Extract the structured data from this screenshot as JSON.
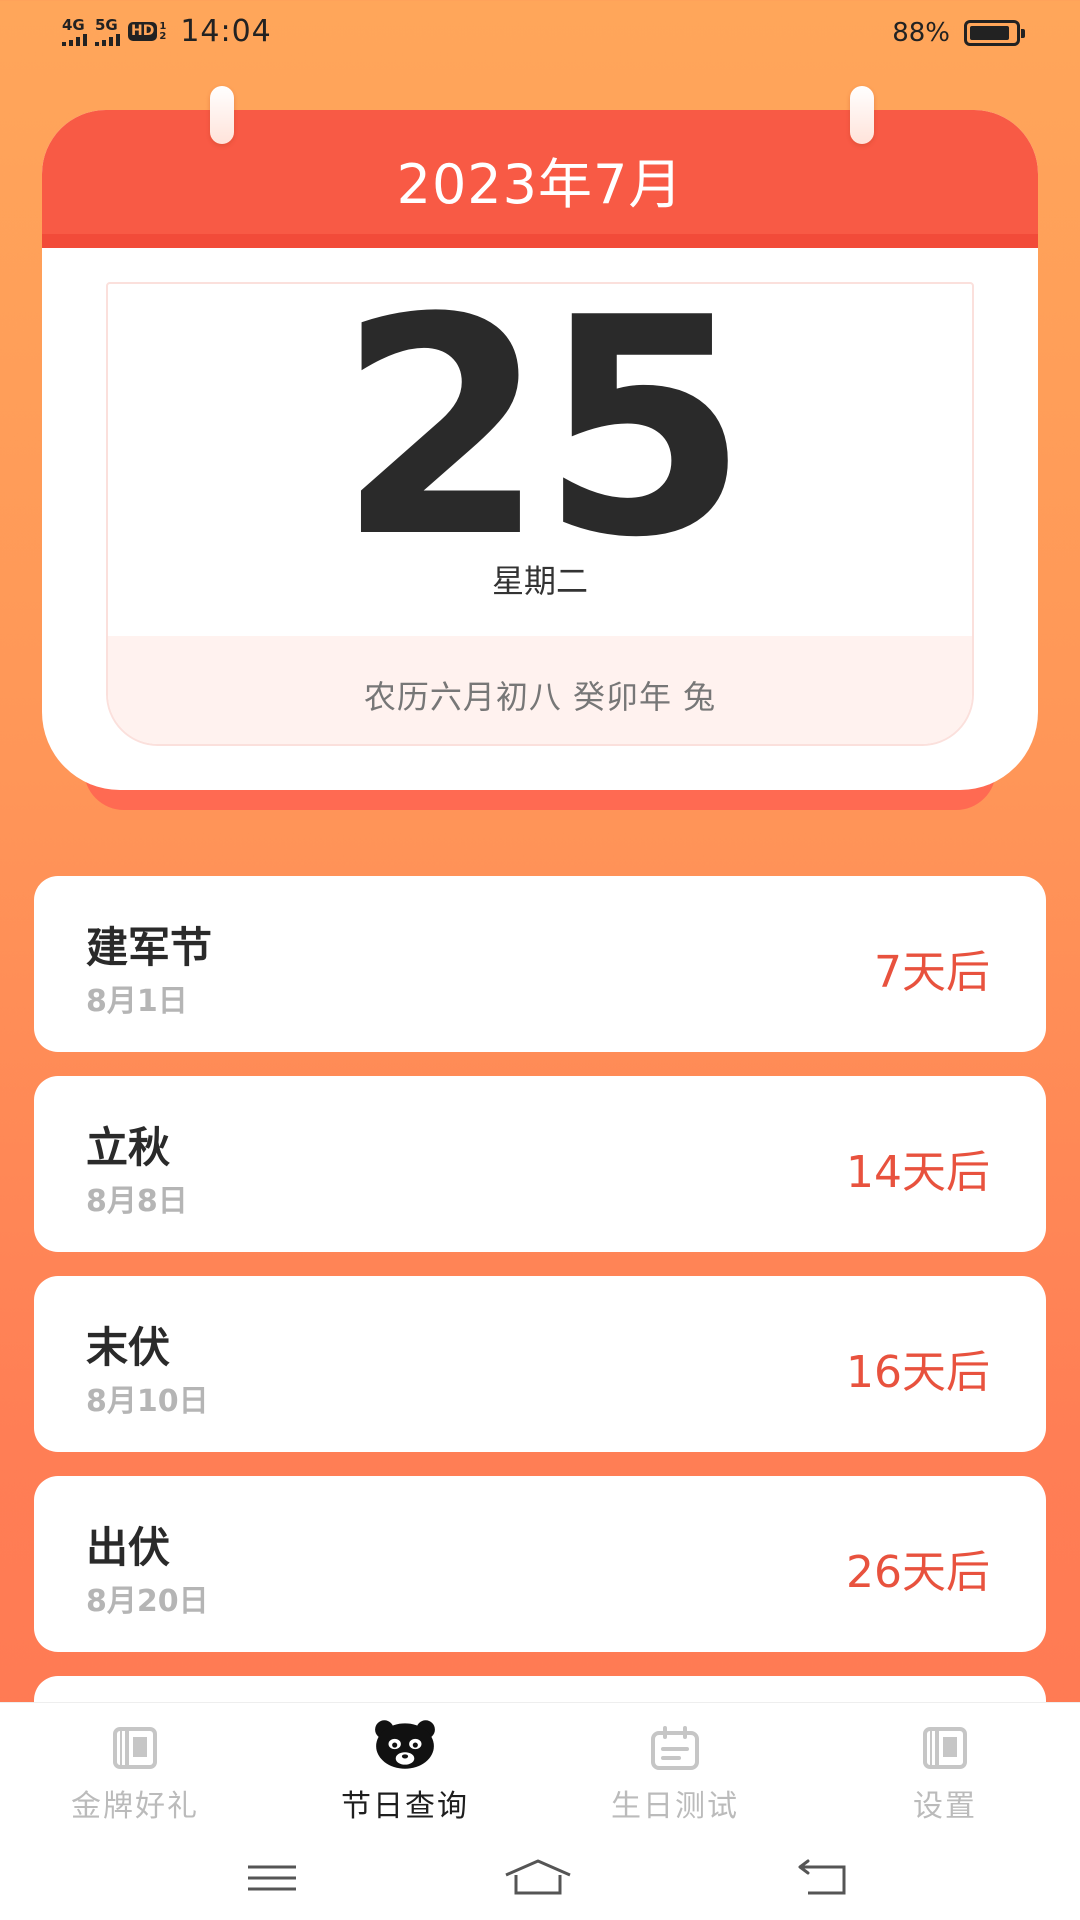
{
  "status_bar": {
    "net1": "4G",
    "net2": "5G",
    "hd": "HD",
    "hd_sup": "1",
    "hd_sub": "2",
    "time": "14:04",
    "battery_pct": "88%",
    "battery_level": 0.88
  },
  "calendar": {
    "month_title": "2023年7月",
    "day": "25",
    "weekday": "星期二",
    "lunar": "农历六月初八 癸卯年 兔"
  },
  "holidays": [
    {
      "name": "建军节",
      "date": "8月1日",
      "countdown": "7天后"
    },
    {
      "name": "立秋",
      "date": "8月8日",
      "countdown": "14天后"
    },
    {
      "name": "末伏",
      "date": "8月10日",
      "countdown": "16天后"
    },
    {
      "name": "出伏",
      "date": "8月20日",
      "countdown": "26天后"
    }
  ],
  "tabs": [
    {
      "label": "金牌好礼",
      "icon": "book-icon"
    },
    {
      "label": "节日查询",
      "icon": "panda-icon"
    },
    {
      "label": "生日测试",
      "icon": "calendar-icon"
    },
    {
      "label": "设置",
      "icon": "book-icon"
    }
  ],
  "colors": {
    "accent": "#F85A45",
    "countdown": "#E8523E",
    "background_top": "#FFA65A",
    "background_bottom": "#FF7853"
  }
}
